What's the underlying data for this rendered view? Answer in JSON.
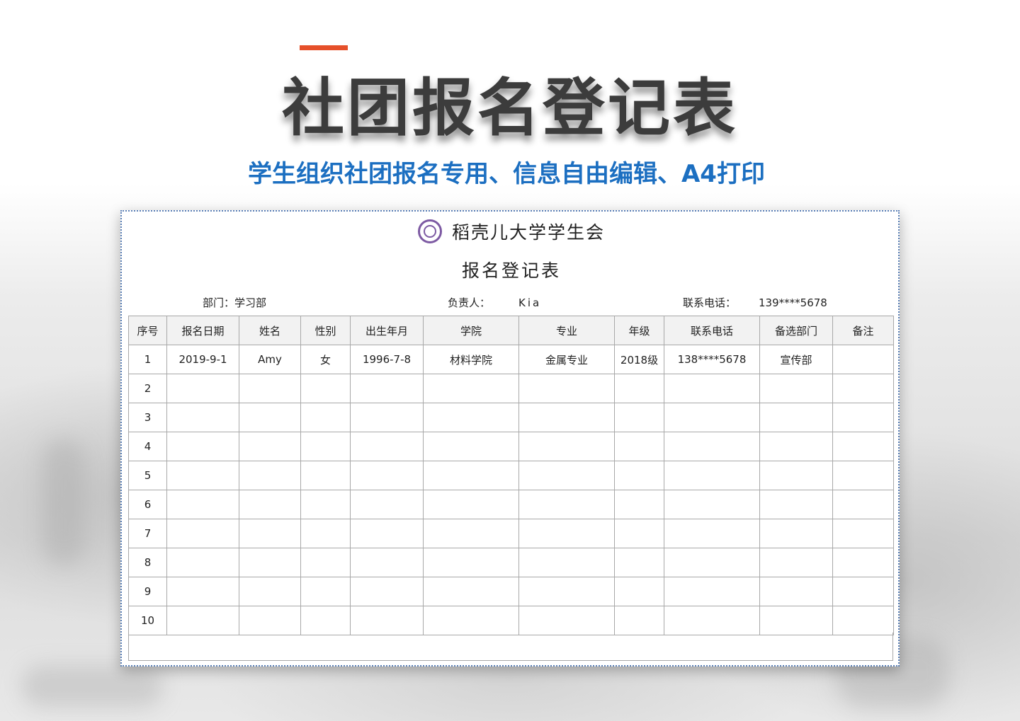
{
  "title": "社团报名登记表",
  "subtitle": "学生组织社团报名专用、信息自由编辑、A4打印",
  "colors": {
    "accent": "#e6502a",
    "subtitle": "#1c6fc1",
    "title": "#3c3c3c",
    "logo": "#7d5aa3"
  },
  "sheet": {
    "org_name": "稻壳儿大学学生会",
    "form_title": "报名登记表",
    "info": {
      "department_label": "部门：",
      "department_value": "学习部",
      "leader_label": "负责人：",
      "leader_value": "Kia",
      "phone_label": "联系电话：",
      "phone_value": "139****5678"
    },
    "columns": [
      "序号",
      "报名日期",
      "姓名",
      "性别",
      "出生年月",
      "学院",
      "专业",
      "年级",
      "联系电话",
      "备选部门",
      "备注"
    ],
    "rows": [
      [
        "1",
        "2019-9-1",
        "Amy",
        "女",
        "1996-7-8",
        "材料学院",
        "金属专业",
        "2018级",
        "138****5678",
        "宣传部",
        ""
      ],
      [
        "2",
        "",
        "",
        "",
        "",
        "",
        "",
        "",
        "",
        "",
        ""
      ],
      [
        "3",
        "",
        "",
        "",
        "",
        "",
        "",
        "",
        "",
        "",
        ""
      ],
      [
        "4",
        "",
        "",
        "",
        "",
        "",
        "",
        "",
        "",
        "",
        ""
      ],
      [
        "5",
        "",
        "",
        "",
        "",
        "",
        "",
        "",
        "",
        "",
        ""
      ],
      [
        "6",
        "",
        "",
        "",
        "",
        "",
        "",
        "",
        "",
        "",
        ""
      ],
      [
        "7",
        "",
        "",
        "",
        "",
        "",
        "",
        "",
        "",
        "",
        ""
      ],
      [
        "8",
        "",
        "",
        "",
        "",
        "",
        "",
        "",
        "",
        "",
        ""
      ],
      [
        "9",
        "",
        "",
        "",
        "",
        "",
        "",
        "",
        "",
        "",
        ""
      ],
      [
        "10",
        "",
        "",
        "",
        "",
        "",
        "",
        "",
        "",
        "",
        ""
      ]
    ]
  }
}
